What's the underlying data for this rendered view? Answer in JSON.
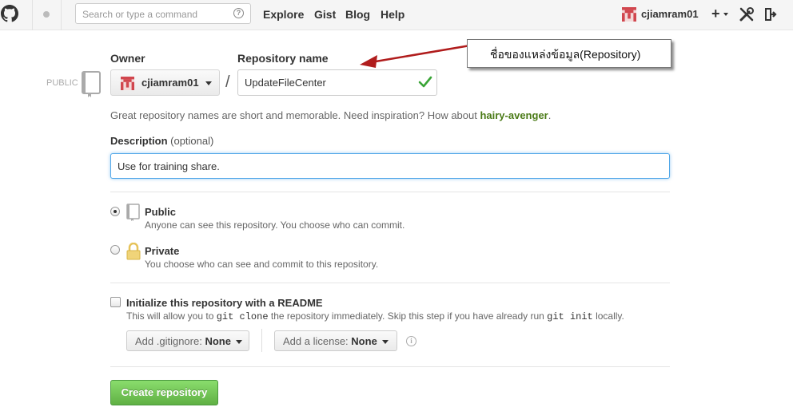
{
  "header": {
    "search_placeholder": "Search or type a command",
    "search_help": "?",
    "nav": [
      "Explore",
      "Gist",
      "Blog",
      "Help"
    ],
    "username": "cjiamram01",
    "plus": "+"
  },
  "form": {
    "public_label": "PUBLIC",
    "owner_label": "Owner",
    "owner_value": "cjiamram01",
    "slash": "/",
    "repo_label": "Repository name",
    "repo_value": "UpdateFileCenter",
    "callout": "ชื่อของแหล่งข้อมูล(Repository)",
    "hint_prefix": "Great repository names are short and memorable. Need inspiration? How about ",
    "hint_suggestion": "hairy-avenger",
    "hint_suffix": ".",
    "description_label": "Description",
    "description_optional": "(optional)",
    "description_value": "Use for training share.",
    "visibility": [
      {
        "title": "Public",
        "subtitle": "Anyone can see this repository. You choose who can commit.",
        "selected": true
      },
      {
        "title": "Private",
        "subtitle": "You choose who can see and commit to this repository.",
        "selected": false
      }
    ],
    "init": {
      "title": "Initialize this repository with a README",
      "sub_1": "This will allow you to ",
      "code_1": "git clone",
      "sub_2": " the repository immediately. Skip this step if you have already run ",
      "code_2": "git init",
      "sub_3": " locally.",
      "checked": false
    },
    "gitignore_label": "Add .gitignore:",
    "gitignore_value": "None",
    "license_label": "Add a license:",
    "license_value": "None",
    "info": "i",
    "create_button": "Create repository"
  },
  "colors": {
    "accent_green": "#60b044",
    "focus_blue": "#51a7e8",
    "arrow_red": "#b01c1c",
    "avatar_red": "#d1464e"
  }
}
